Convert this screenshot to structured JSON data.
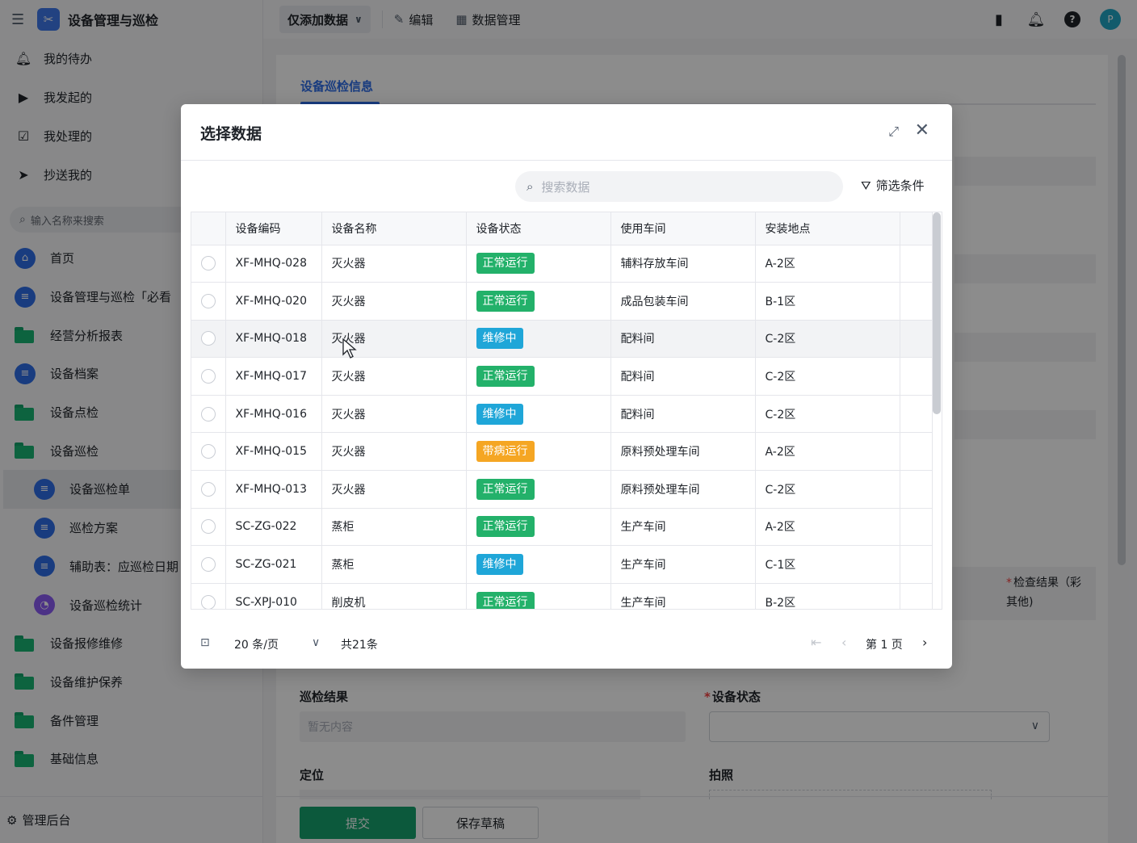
{
  "app": {
    "title": "设备管理与巡检"
  },
  "sidebar": {
    "nav": [
      {
        "label": "我的待办",
        "icon": "bell-icon"
      },
      {
        "label": "我发起的",
        "icon": "play-icon"
      },
      {
        "label": "我处理的",
        "icon": "inbox-icon"
      },
      {
        "label": "抄送我的",
        "icon": "send-icon"
      }
    ],
    "search_placeholder": "输入名称来搜索",
    "menu": [
      {
        "label": "首页",
        "icon": "home-icon"
      },
      {
        "label": "设备管理与巡检「必看",
        "icon": "doc-icon"
      },
      {
        "label": "经营分析报表",
        "icon": "folder-icon"
      },
      {
        "label": "设备档案",
        "icon": "doc-icon"
      },
      {
        "label": "设备点检",
        "icon": "folder-icon"
      },
      {
        "label": "设备巡检",
        "icon": "folder-icon"
      },
      {
        "label": "设备巡检单",
        "icon": "doc-icon"
      },
      {
        "label": "巡检方案",
        "icon": "doc-icon"
      },
      {
        "label": "辅助表：应巡检日期",
        "icon": "doc-icon"
      },
      {
        "label": "设备巡检统计",
        "icon": "chart-icon"
      },
      {
        "label": "设备报修维修",
        "icon": "folder-icon"
      },
      {
        "label": "设备维护保养",
        "icon": "folder-icon"
      },
      {
        "label": "备件管理",
        "icon": "folder-icon"
      },
      {
        "label": "基础信息",
        "icon": "folder-icon"
      }
    ],
    "footer_label": "管理后台"
  },
  "topbar": {
    "mode_label": "仅添加数据",
    "edit_label": "编辑",
    "data_manage_label": "数据管理",
    "avatar_text": "P",
    "help_text": "?"
  },
  "form": {
    "tab_label": "设备巡检信息",
    "col_fragment_1": "检查结果（彩",
    "col_fragment_2": "其他)",
    "inspection_result_label": "巡检结果",
    "inspection_result_placeholder": "暂无内容",
    "device_status_label": "设备状态",
    "location_label": "定位",
    "photo_label": "拍照",
    "submit_label": "提交",
    "draft_label": "保存草稿"
  },
  "modal": {
    "title": "选择数据",
    "search_placeholder": "搜索数据",
    "filter_label": "筛选条件",
    "columns": [
      "设备编码",
      "设备名称",
      "设备状态",
      "使用车间",
      "安装地点"
    ],
    "rows": [
      {
        "code": "XF-MHQ-028",
        "name": "灭火器",
        "status": "正常运行",
        "status_color": "#23b16a",
        "workshop": "辅料存放车间",
        "location": "A-2区"
      },
      {
        "code": "XF-MHQ-020",
        "name": "灭火器",
        "status": "正常运行",
        "status_color": "#23b16a",
        "workshop": "成品包装车间",
        "location": "B-1区"
      },
      {
        "code": "XF-MHQ-018",
        "name": "灭火器",
        "status": "维修中",
        "status_color": "#1fa6d8",
        "workshop": "配料间",
        "location": "C-2区"
      },
      {
        "code": "XF-MHQ-017",
        "name": "灭火器",
        "status": "正常运行",
        "status_color": "#23b16a",
        "workshop": "配料间",
        "location": "C-2区"
      },
      {
        "code": "XF-MHQ-016",
        "name": "灭火器",
        "status": "维修中",
        "status_color": "#1fa6d8",
        "workshop": "配料间",
        "location": "C-2区"
      },
      {
        "code": "XF-MHQ-015",
        "name": "灭火器",
        "status": "带病运行",
        "status_color": "#f5a623",
        "workshop": "原料预处理车间",
        "location": "A-2区"
      },
      {
        "code": "XF-MHQ-013",
        "name": "灭火器",
        "status": "正常运行",
        "status_color": "#23b16a",
        "workshop": "原料预处理车间",
        "location": "C-2区"
      },
      {
        "code": "SC-ZG-022",
        "name": "蒸柜",
        "status": "正常运行",
        "status_color": "#23b16a",
        "workshop": "生产车间",
        "location": "A-2区"
      },
      {
        "code": "SC-ZG-021",
        "name": "蒸柜",
        "status": "维修中",
        "status_color": "#1fa6d8",
        "workshop": "生产车间",
        "location": "C-1区"
      },
      {
        "code": "SC-XPJ-010",
        "name": "削皮机",
        "status": "正常运行",
        "status_color": "#23b16a",
        "workshop": "生产车间",
        "location": "B-2区"
      }
    ],
    "pager": {
      "page_size": "20 条/页",
      "total": "共21条",
      "page": "第 1 页"
    }
  },
  "colors": {
    "primary": "#2f6ee8",
    "success": "#23b16a",
    "repair": "#1fa6d8",
    "warning": "#f5a623",
    "submit": "#17a36e"
  }
}
